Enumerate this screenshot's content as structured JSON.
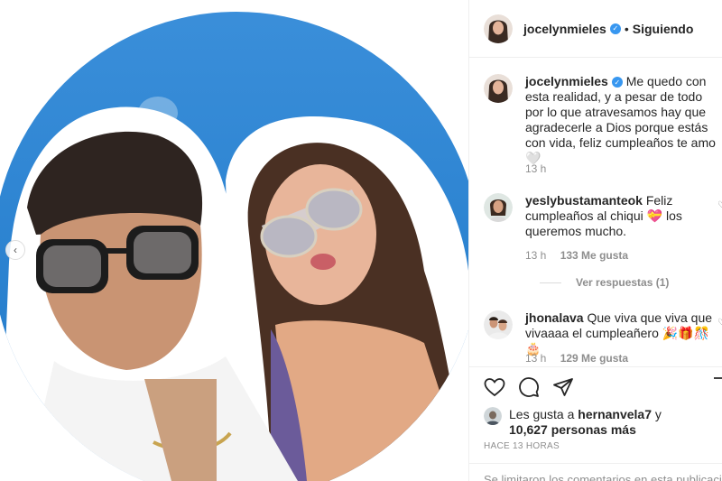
{
  "post": {
    "username": "jocelynmieles",
    "follow_status": "Siguiendo",
    "prev_icon": "chevron-left-icon"
  },
  "caption": {
    "username": "jocelynmieles",
    "text": "Me quedo con esta realidad, y a pesar de todo por lo que atravesamos hay que agradecerle a Dios porque estás con vida, feliz cumpleaños te amo🤍",
    "time": "13 h"
  },
  "comments": [
    {
      "username": "yeslybustamanteok",
      "text": "Feliz cumpleaños al chiqui 💝 los queremos mucho.",
      "time": "13 h",
      "likes": "133 Me gusta",
      "replies": "Ver respuestas (1)"
    },
    {
      "username": "jhonalava",
      "text": "Que viva que viva que vivaaaa el cumpleañero 🎉🎁🎊🎂",
      "time": "13 h",
      "likes": "129 Me gusta"
    }
  ],
  "likes": {
    "prefix": "Les gusta a",
    "user": "hernanvela7",
    "joiner": "y",
    "count": "10,627 personas más"
  },
  "timestamp": "HACE 13 HORAS",
  "limited_notice": "Se limitaron los comentarios en esta publicación",
  "colors": {
    "verified": "#3897f0",
    "sky": "#3a8fd9"
  }
}
